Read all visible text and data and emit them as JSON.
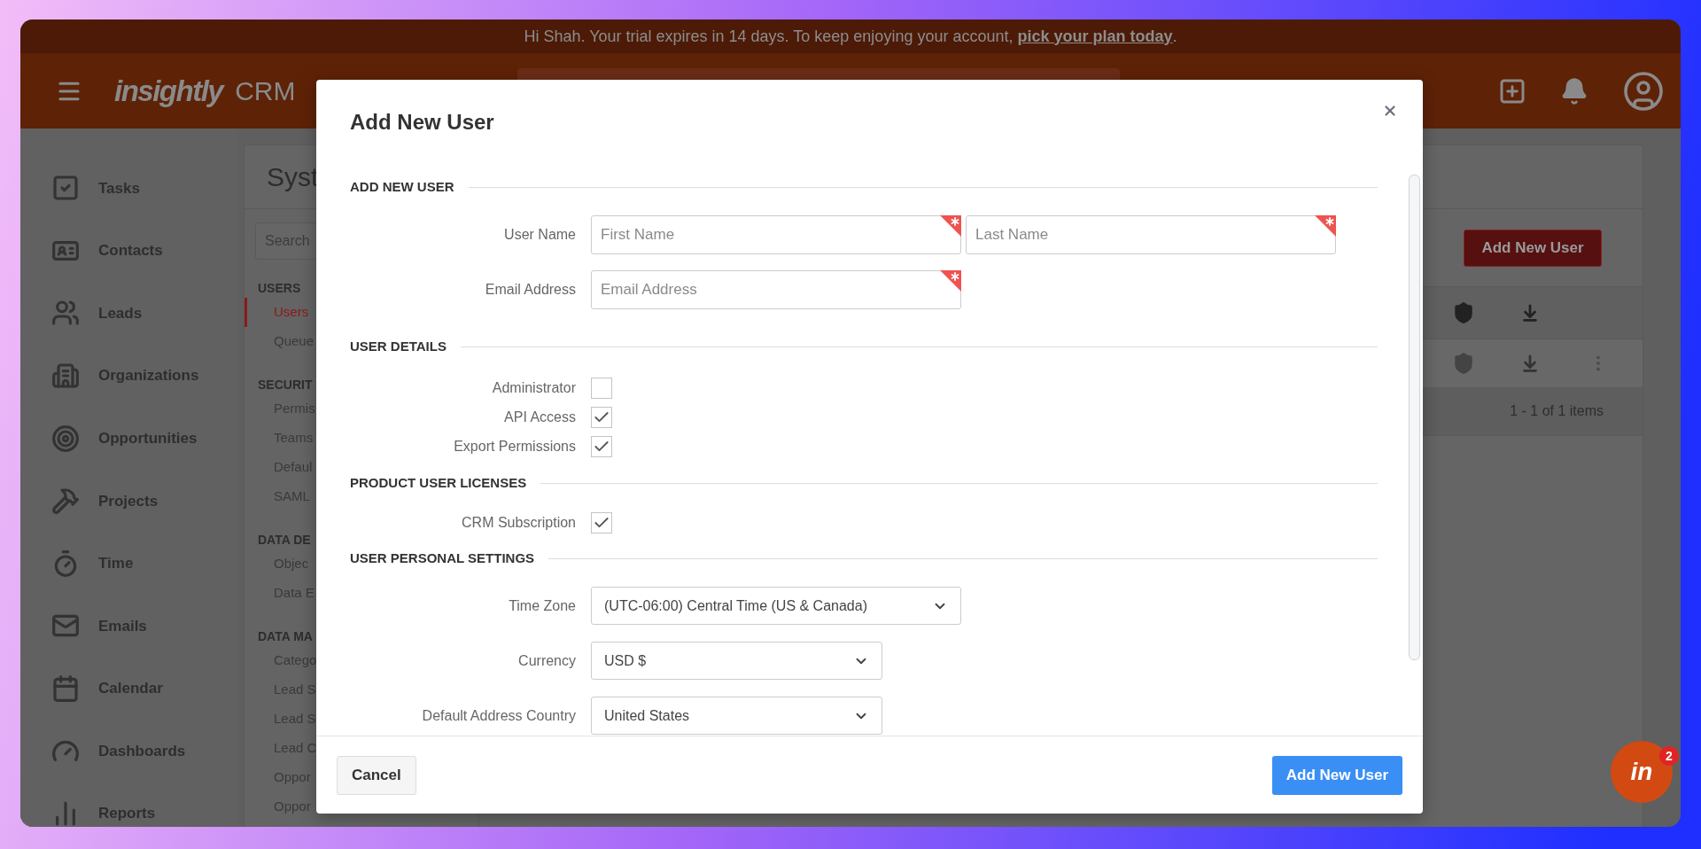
{
  "banner": {
    "text": "Hi Shah. Your trial expires in 14 days. To keep enjoying your account,",
    "link": "pick your plan today",
    "trailing": "."
  },
  "header": {
    "logo": "insightly",
    "product": "CRM"
  },
  "sidebar": {
    "items": [
      {
        "label": "Tasks"
      },
      {
        "label": "Contacts"
      },
      {
        "label": "Leads"
      },
      {
        "label": "Organizations"
      },
      {
        "label": "Opportunities"
      },
      {
        "label": "Projects"
      },
      {
        "label": "Time"
      },
      {
        "label": "Emails"
      },
      {
        "label": "Calendar"
      },
      {
        "label": "Dashboards"
      },
      {
        "label": "Reports"
      }
    ]
  },
  "settings_panel": {
    "title": "Syst",
    "search": {
      "placeholder": "Search"
    },
    "groups": [
      {
        "heading": "USERS",
        "items": [
          {
            "label": "Users",
            "selected": true
          },
          {
            "label": "Queue",
            "selected": false
          }
        ]
      },
      {
        "heading": "SECURIT",
        "items": [
          {
            "label": "Permis",
            "selected": false
          },
          {
            "label": "Teams",
            "selected": false
          },
          {
            "label": "Defaul",
            "selected": false
          },
          {
            "label": "SAML",
            "selected": false
          }
        ]
      },
      {
        "heading": "DATA DE",
        "items": [
          {
            "label": "Objec",
            "selected": false
          },
          {
            "label": "Data E",
            "selected": false
          }
        ]
      },
      {
        "heading": "DATA MA",
        "items": [
          {
            "label": "Catego",
            "selected": false
          },
          {
            "label": "Lead S",
            "selected": false
          },
          {
            "label": "Lead S",
            "selected": false
          },
          {
            "label": "Lead C",
            "selected": false
          },
          {
            "label": "Oppor",
            "selected": false
          },
          {
            "label": "Oppor",
            "selected": false
          }
        ]
      }
    ]
  },
  "users_table": {
    "button": "Add New User",
    "pagination": "1 - 1 of 1 items"
  },
  "modal": {
    "title": "Add New User",
    "sections": [
      {
        "heading": "ADD NEW USER",
        "rows": [
          {
            "kind": "text_fields",
            "label": "User Name",
            "fields": [
              {
                "placeholder": "First Name",
                "required": true
              },
              {
                "placeholder": "Last Name",
                "required": true
              }
            ]
          },
          {
            "kind": "text_fields",
            "label": "Email Address",
            "fields": [
              {
                "placeholder": "Email Address",
                "required": true
              }
            ]
          }
        ]
      },
      {
        "heading": "USER DETAILS",
        "rows": [
          {
            "kind": "checkbox",
            "label": "Administrator",
            "checked": false
          },
          {
            "kind": "checkbox",
            "label": "API Access",
            "checked": true
          },
          {
            "kind": "checkbox",
            "label": "Export Permissions",
            "checked": true
          }
        ]
      },
      {
        "heading": "PRODUCT USER LICENSES",
        "rows": [
          {
            "kind": "checkbox",
            "label": "CRM Subscription",
            "checked": true
          }
        ]
      },
      {
        "heading": "USER PERSONAL SETTINGS",
        "rows": [
          {
            "kind": "select",
            "label": "Time Zone",
            "value": "(UTC-06:00) Central Time (US & Canada)",
            "wide": true
          },
          {
            "kind": "select",
            "label": "Currency",
            "value": "USD $",
            "wide": false
          },
          {
            "kind": "select",
            "label": "Default Address Country",
            "value": "United States",
            "wide": false
          }
        ]
      }
    ],
    "buttons": [
      {
        "label": "Cancel",
        "kind": "secondary"
      },
      {
        "label": "Add New User",
        "kind": "primary"
      }
    ]
  },
  "widget": {
    "logo": "in",
    "badge": "2"
  }
}
